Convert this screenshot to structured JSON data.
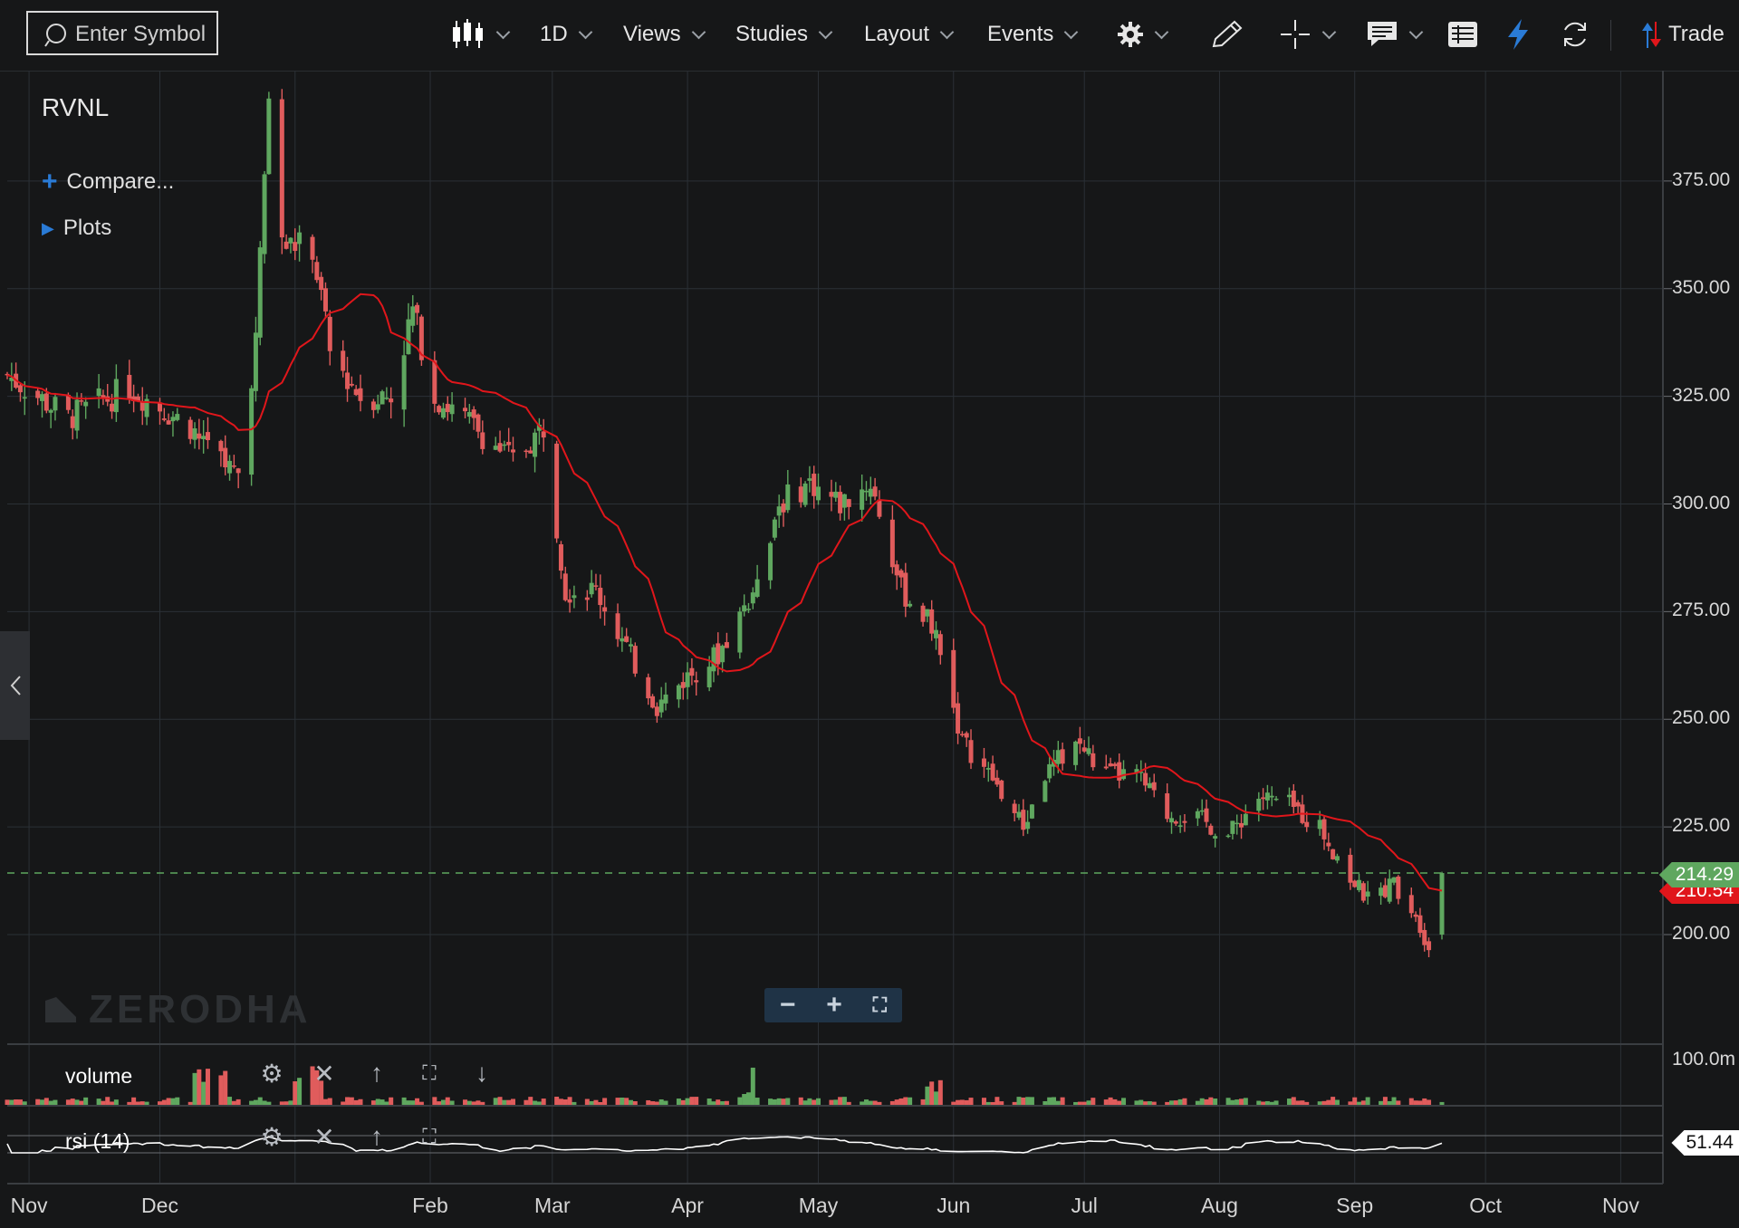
{
  "toolbar": {
    "search_placeholder": "Enter Symbol",
    "interval": "1D",
    "views": "Views",
    "studies": "Studies",
    "layout": "Layout",
    "events": "Events",
    "trade": "Trade"
  },
  "legend": {
    "symbol": "RVNL",
    "compare": "Compare...",
    "plots": "Plots"
  },
  "watermark": "ZERODHA",
  "panes": {
    "volume_label": "volume",
    "volume_axis": "100.0m",
    "rsi_label": "rsi (14)",
    "rsi_value": "51.44"
  },
  "price_tags": {
    "last": "214.29",
    "ma": "210.54"
  },
  "colors": {
    "up": "#5fa75f",
    "down": "#e05c5c",
    "ma_line": "#e0161b",
    "accent": "#2a7bd6",
    "background": "#161718"
  },
  "chart_data": {
    "type": "candlestick",
    "symbol": "RVNL",
    "interval": "1D",
    "title": "",
    "xlabel": "",
    "ylabel": "",
    "ylim": [
      180,
      400
    ],
    "y_ticks": [
      "375.00",
      "350.00",
      "325.00",
      "300.00",
      "275.00",
      "250.00",
      "225.00",
      "200.00"
    ],
    "x_ticks": [
      "Nov",
      "Dec",
      "Feb",
      "Mar",
      "Apr",
      "May",
      "Jun",
      "Jul",
      "Aug",
      "Sep",
      "Oct",
      "Nov"
    ],
    "last_price": 214.29,
    "ma_value": 210.54,
    "anchors": [
      [
        "2025-10-27",
        330
      ],
      [
        "2025-11-10",
        320
      ],
      [
        "2025-11-24",
        327
      ],
      [
        "2025-12-08",
        318
      ],
      [
        "2025-12-15",
        310
      ],
      [
        "2025-12-19",
        307
      ],
      [
        "2025-12-23",
        338
      ],
      [
        "2025-12-26",
        395
      ],
      [
        "2025-12-29",
        360
      ],
      [
        "2026-01-05",
        360
      ],
      [
        "2026-01-09",
        335
      ],
      [
        "2026-01-16",
        325
      ],
      [
        "2026-01-23",
        325
      ],
      [
        "2026-01-28",
        345
      ],
      [
        "2026-02-02",
        325
      ],
      [
        "2026-02-11",
        318
      ],
      [
        "2026-02-20",
        310
      ],
      [
        "2026-02-27",
        318
      ],
      [
        "2026-03-04",
        280
      ],
      [
        "2026-03-11",
        280
      ],
      [
        "2026-03-25",
        253
      ],
      [
        "2026-04-01",
        260
      ],
      [
        "2026-04-08",
        265
      ],
      [
        "2026-04-15",
        278
      ],
      [
        "2026-04-22",
        300
      ],
      [
        "2026-04-29",
        305
      ],
      [
        "2026-05-06",
        300
      ],
      [
        "2026-05-13",
        305
      ],
      [
        "2026-05-20",
        280
      ],
      [
        "2026-05-27",
        272
      ],
      [
        "2026-06-03",
        245
      ],
      [
        "2026-06-10",
        236
      ],
      [
        "2026-06-17",
        225
      ],
      [
        "2026-06-22",
        237
      ],
      [
        "2026-06-29",
        245
      ],
      [
        "2026-07-06",
        237
      ],
      [
        "2026-07-13",
        237
      ],
      [
        "2026-07-20",
        228
      ],
      [
        "2026-07-27",
        227
      ],
      [
        "2026-08-03",
        223
      ],
      [
        "2026-08-10",
        232
      ],
      [
        "2026-08-17",
        230
      ],
      [
        "2026-08-24",
        225
      ],
      [
        "2026-08-31",
        213
      ],
      [
        "2026-09-04",
        208
      ],
      [
        "2026-09-10",
        212
      ],
      [
        "2026-09-15",
        205
      ],
      [
        "2026-09-18",
        197
      ],
      [
        "2026-09-21",
        214.29
      ]
    ]
  }
}
